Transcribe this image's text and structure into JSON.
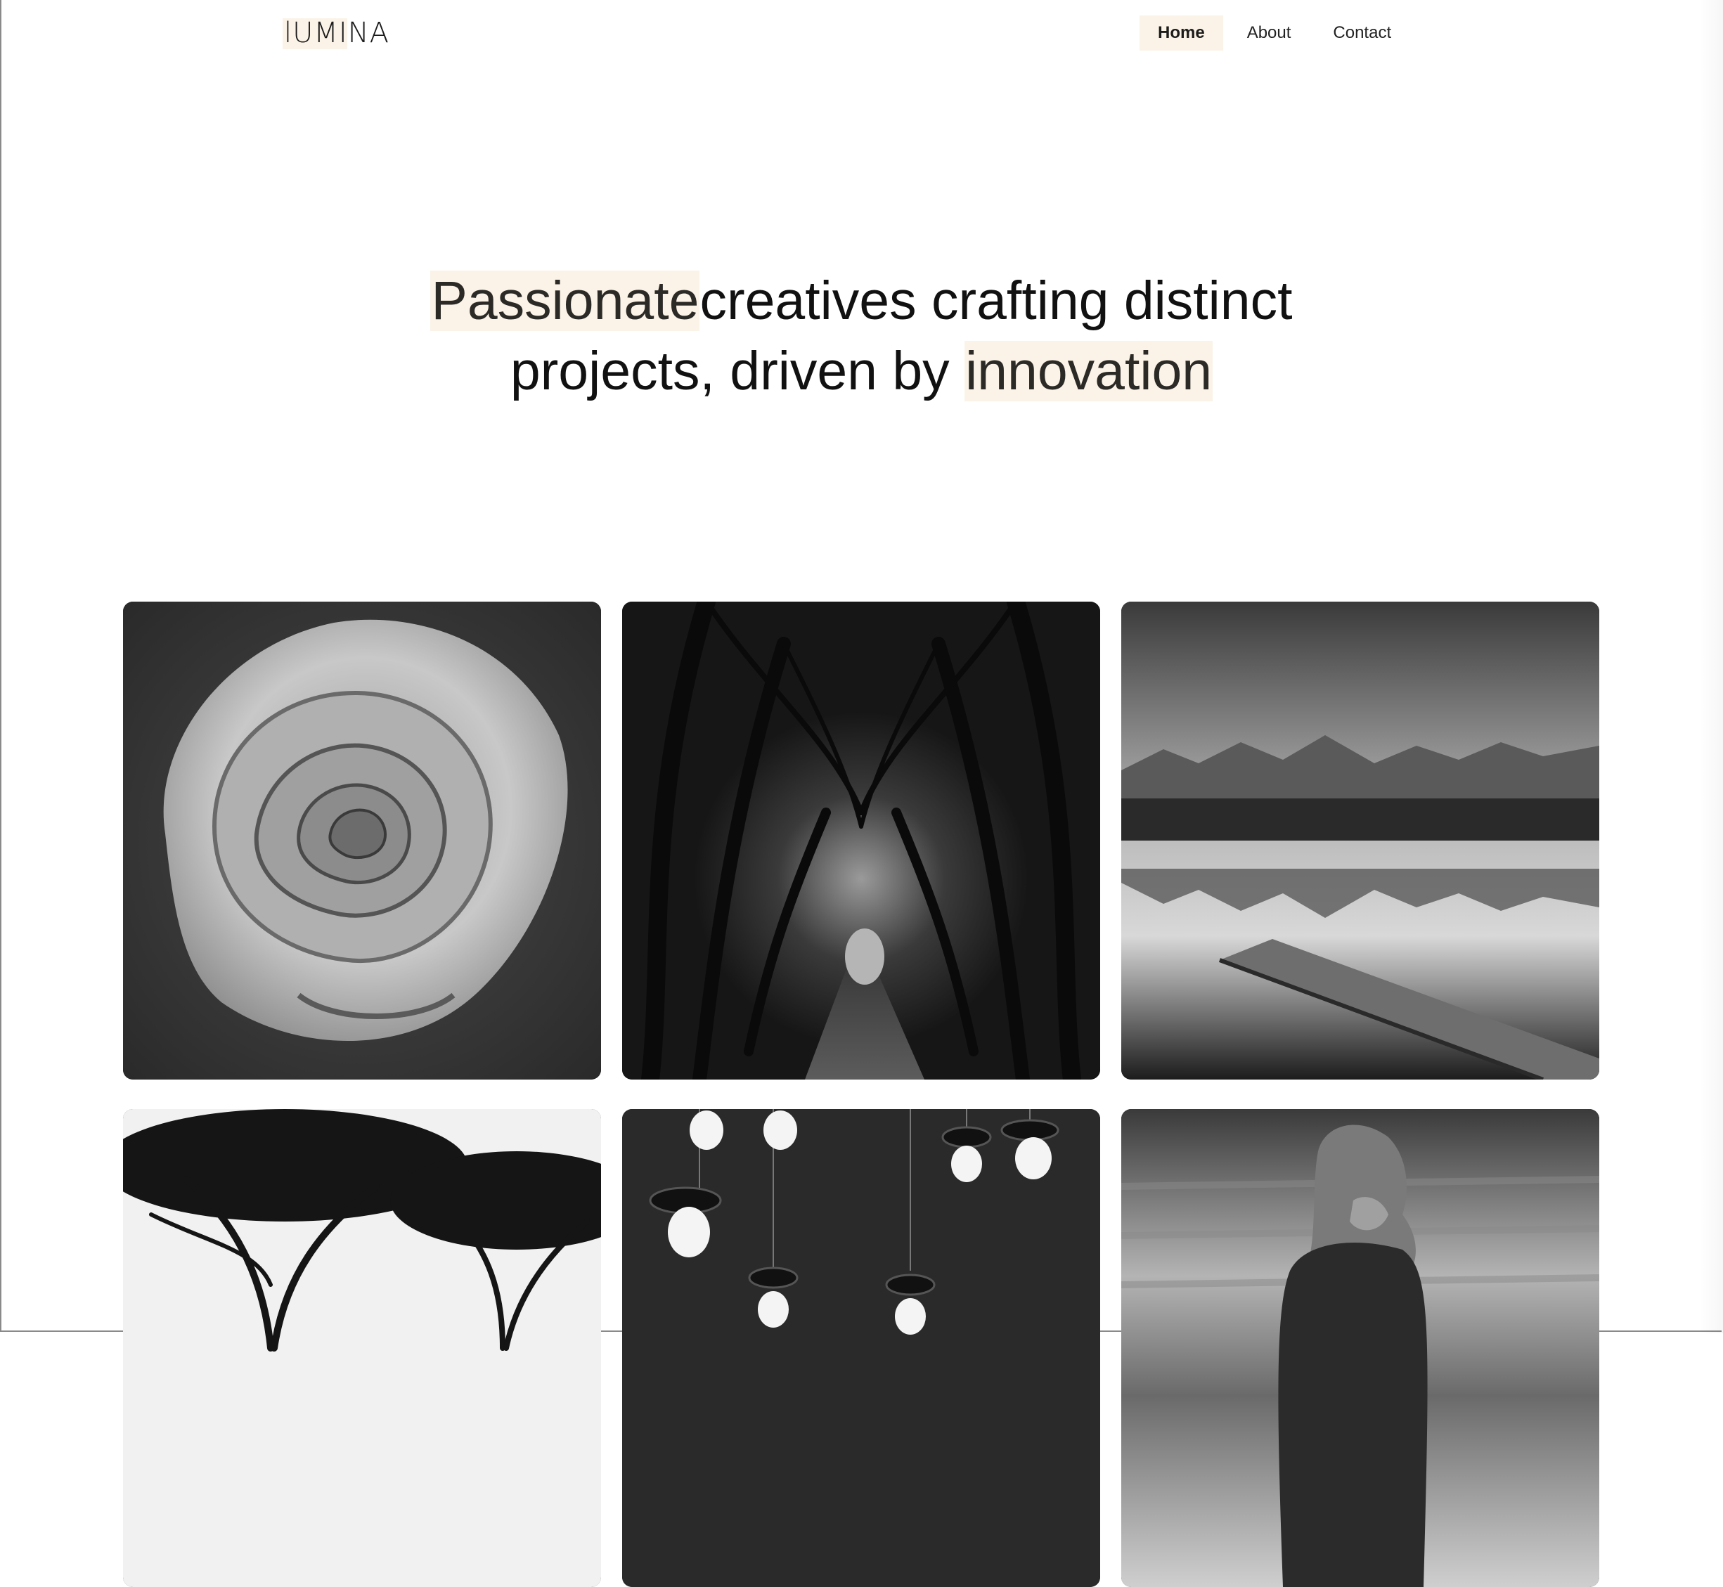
{
  "brand": {
    "logo": "lUMINA"
  },
  "nav": {
    "items": [
      {
        "label": "Home",
        "active": true
      },
      {
        "label": "About",
        "active": false
      },
      {
        "label": "Contact",
        "active": false
      }
    ]
  },
  "hero": {
    "highlight_1": "Passionate",
    "line_1_rest": "creatives crafting distinct",
    "line_2_start": "projects, driven by ",
    "highlight_2": "innovation"
  },
  "gallery": {
    "images": [
      {
        "subject": "rose"
      },
      {
        "subject": "tree-tunnel"
      },
      {
        "subject": "mountain-lake-dock"
      },
      {
        "subject": "tree-silhouettes"
      },
      {
        "subject": "hanging-bulbs"
      },
      {
        "subject": "girl-in-field"
      }
    ]
  },
  "colors": {
    "highlight": "#fbf3e7",
    "text": "#111111",
    "background": "#ffffff"
  }
}
